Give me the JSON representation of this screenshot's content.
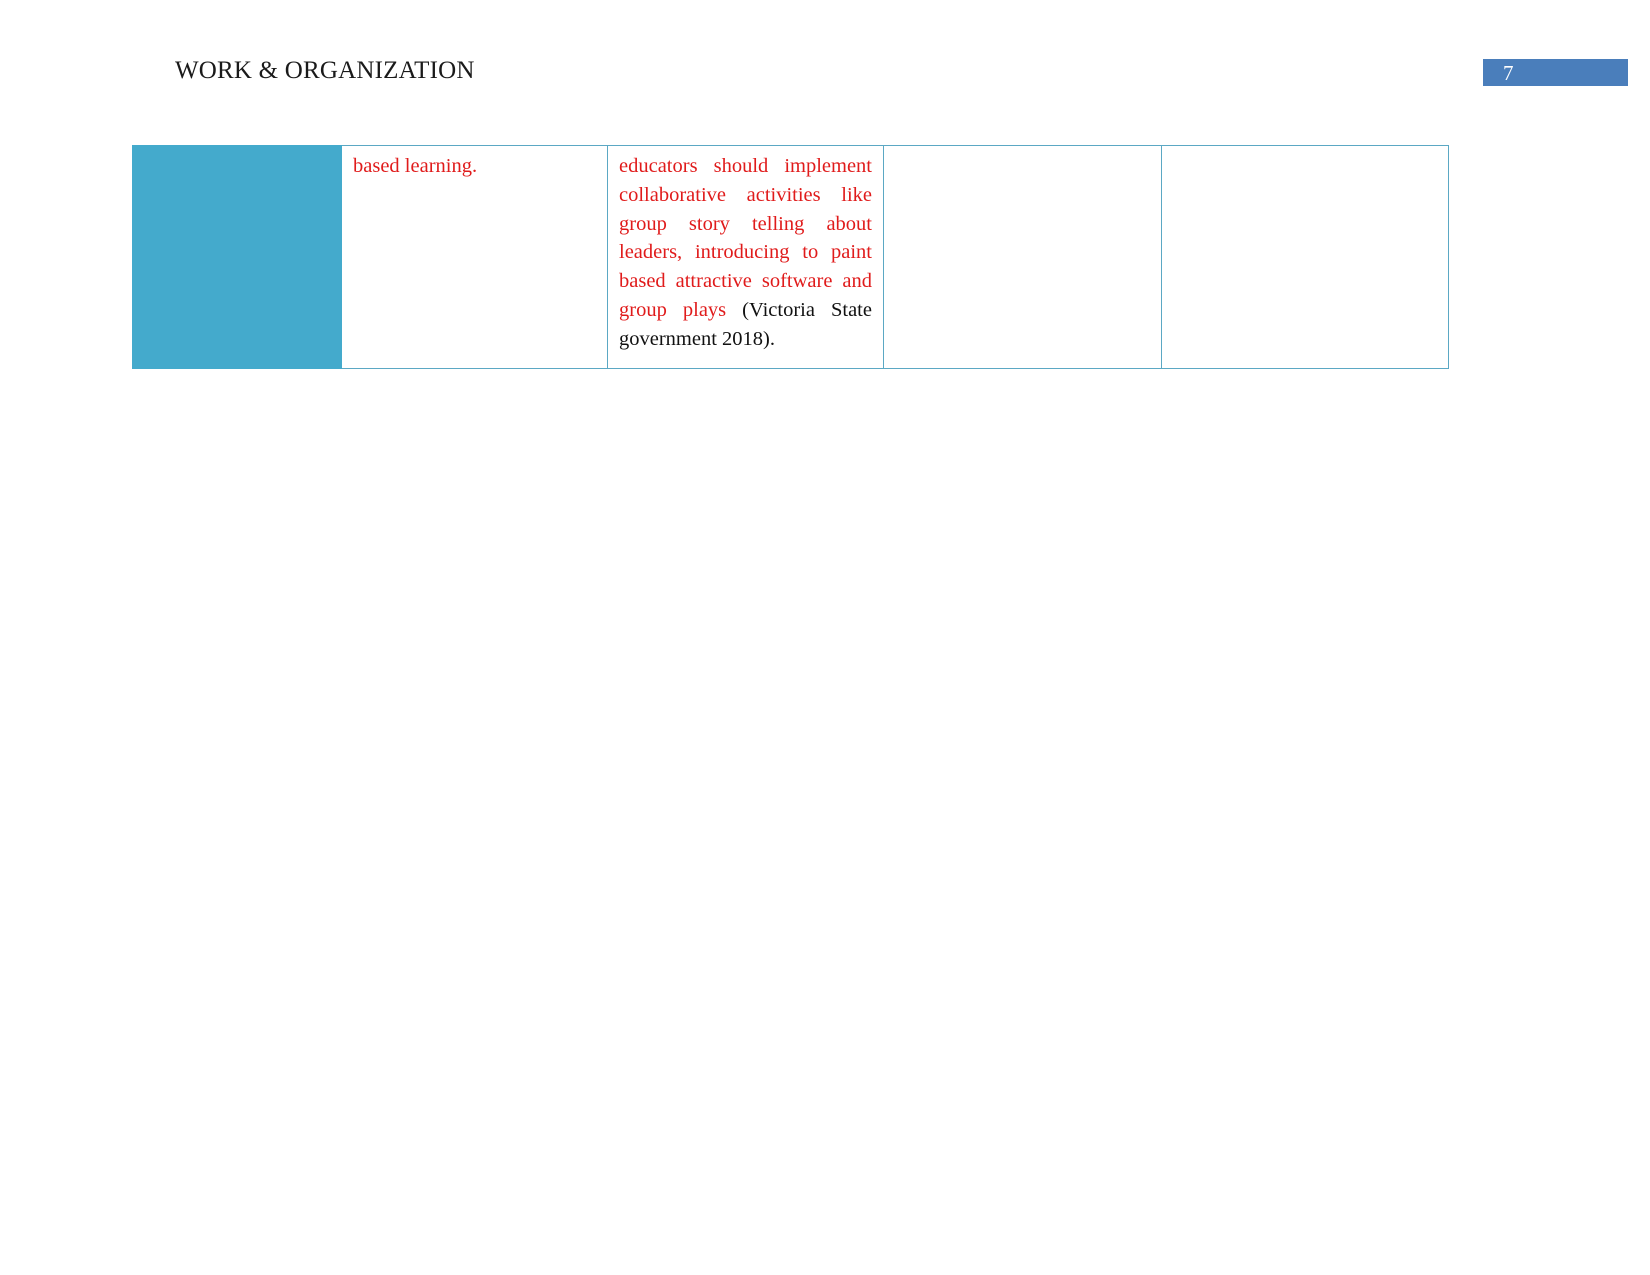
{
  "document": {
    "page_background": "#ffffff",
    "accent_color": "#44aacc",
    "border_color": "#5ba8c4",
    "badge_color": "#4a7ebb",
    "insertion_color": "#e01b1b"
  },
  "header": {
    "title": "WORK & ORGANIZATION",
    "page_number": "7"
  },
  "table": {
    "columns": [
      {
        "id": "col-accent",
        "type": "accent-fill",
        "content": ""
      },
      {
        "id": "col-b",
        "type": "text",
        "content": "based learning."
      },
      {
        "id": "col-c",
        "type": "text",
        "content": "educators should implement collaborative activities like group story telling about leaders, introducing to paint based attractive software and group plays (Victoria State government 2018)."
      },
      {
        "id": "col-d",
        "type": "text",
        "content": ""
      },
      {
        "id": "col-e",
        "type": "text",
        "content": ""
      }
    ],
    "cells": {
      "b_text_red": "based learning.",
      "c_text_red": "educators should implement collaborative activities like group story telling about leaders, introducing to paint based attractive software and group plays",
      "c_text_black": " (Victoria State government 2018).",
      "d_text": "",
      "e_text": ""
    }
  }
}
